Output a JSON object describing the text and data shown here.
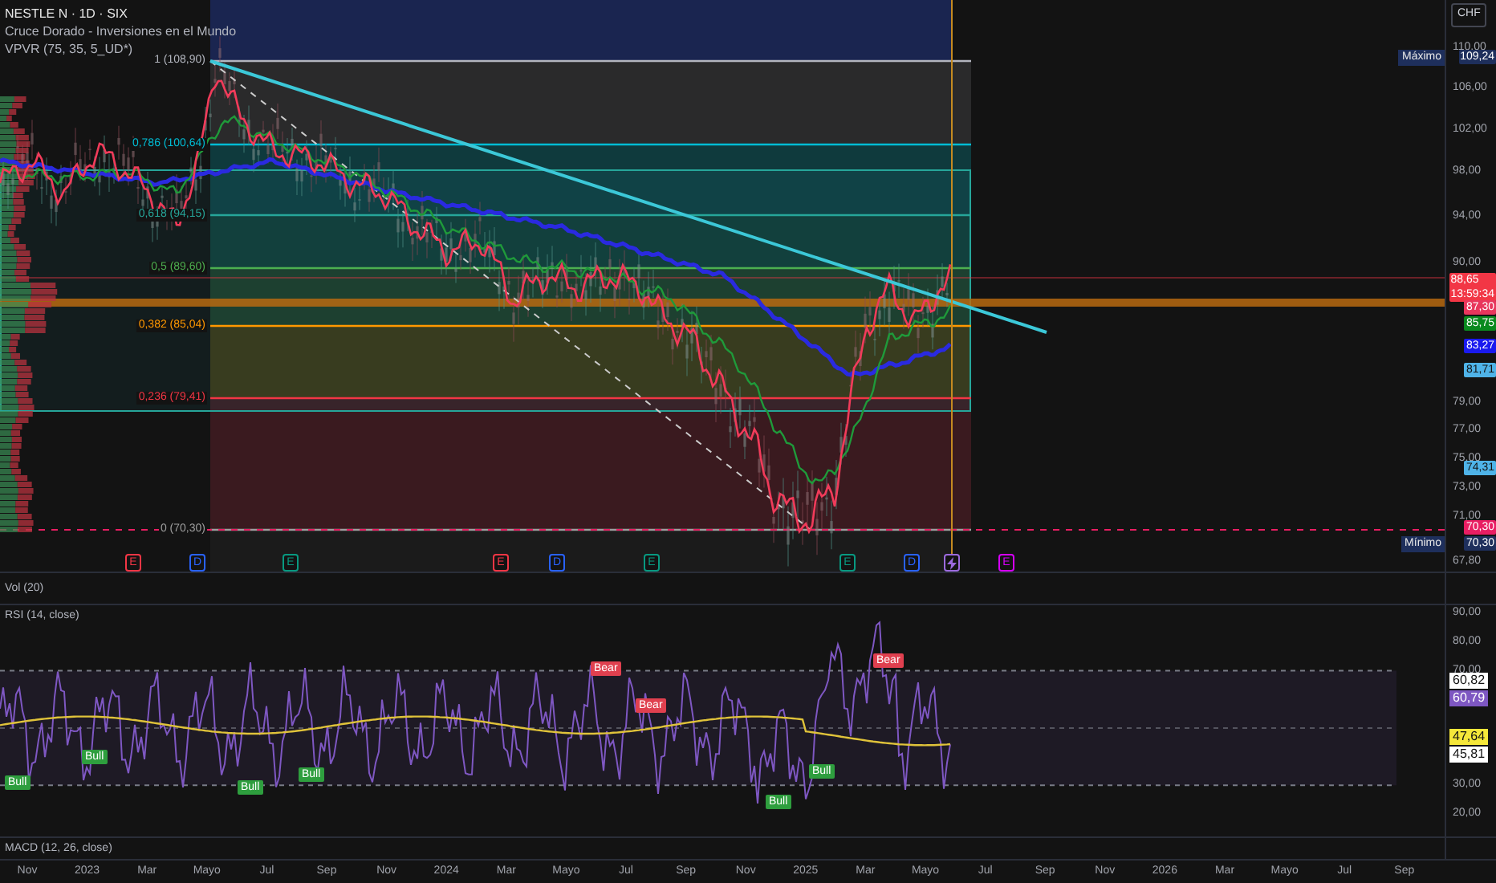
{
  "legend": [
    "NESTLE N · 1D · SIX",
    "Cruce Dorado - Inversiones en el Mundo",
    "VPVR (75, 35, 5_UD*)"
  ],
  "currency_button": "CHF",
  "price_axis": [
    "110,00",
    "106,00",
    "102,00",
    "98,00",
    "94,00",
    "90,00",
    "79,00",
    "77,00",
    "75,00",
    "73,00",
    "71,00",
    "67,80"
  ],
  "price_badges": [
    {
      "kind": "extreme",
      "label": "Máximo",
      "value": "109,24",
      "color": "#1e2f5c"
    },
    {
      "kind": "last",
      "value": "88,65",
      "countdown": "13:59:34",
      "color": "#f23645"
    },
    {
      "kind": "level",
      "value": "87,30",
      "color": "#e8365d"
    },
    {
      "kind": "level",
      "value": "85,75",
      "color": "#0a8a1e"
    },
    {
      "kind": "level",
      "value": "83,27",
      "color": "#1a1aef"
    },
    {
      "kind": "level",
      "value": "81,71",
      "color": "#4fb3e8"
    },
    {
      "kind": "level",
      "value": "74,31",
      "color": "#4fb3e8"
    },
    {
      "kind": "level",
      "value": "70,30",
      "color": "#e91e63"
    },
    {
      "kind": "extreme",
      "label": "Mínimo",
      "value": "70,30",
      "color": "#1e2f5c"
    }
  ],
  "fib_levels": [
    {
      "label": "1 (108,90)",
      "color": "#b2b5be"
    },
    {
      "label": "0,786 (100,64)",
      "color": "#00bcd4"
    },
    {
      "label": "0,618 (94,15)",
      "color": "#26a69a"
    },
    {
      "label": "0,5 (89,60)",
      "color": "#4caf50"
    },
    {
      "label": "0,382 (85,04)",
      "color": "#ff9800"
    },
    {
      "label": "0,236 (79,41)",
      "color": "#f23645"
    },
    {
      "label": "0 (70,30)",
      "color": "#9e9e9e"
    }
  ],
  "events": [
    {
      "kind": "earnings",
      "text": "E",
      "color": "#f23645"
    },
    {
      "kind": "dividend",
      "text": "D",
      "color": "#2962ff"
    },
    {
      "kind": "earnings",
      "text": "E",
      "color": "#089981"
    },
    {
      "kind": "earnings",
      "text": "E",
      "color": "#f23645"
    },
    {
      "kind": "dividend",
      "text": "D",
      "color": "#2962ff"
    },
    {
      "kind": "earnings",
      "text": "E",
      "color": "#089981"
    },
    {
      "kind": "earnings",
      "text": "E",
      "color": "#089981"
    },
    {
      "kind": "dividend",
      "text": "D",
      "color": "#2962ff"
    },
    {
      "kind": "news",
      "color": "#9c6ade"
    },
    {
      "kind": "earnings",
      "text": "E",
      "color": "#d500f9"
    }
  ],
  "panes": {
    "volume": "Vol (20)",
    "rsi": "RSI (14, close)",
    "macd": "MACD (12, 26, close)"
  },
  "rsi_axis": [
    "90,00",
    "80,00",
    "70,00",
    "30,00",
    "20,00"
  ],
  "rsi_badges": [
    {
      "value": "60,82",
      "color": "#ffffff"
    },
    {
      "value": "60,79",
      "color": "#7e57c2"
    },
    {
      "value": "47,64",
      "color": "#f5e73a"
    },
    {
      "value": "45,81",
      "color": "#ffffff"
    }
  ],
  "signals": [
    {
      "kind": "bull",
      "text": "Bull"
    },
    {
      "kind": "bull",
      "text": "Bull"
    },
    {
      "kind": "bull",
      "text": "Bull"
    },
    {
      "kind": "bull",
      "text": "Bull"
    },
    {
      "kind": "bear",
      "text": "Bear"
    },
    {
      "kind": "bear",
      "text": "Bear"
    },
    {
      "kind": "bull",
      "text": "Bull"
    },
    {
      "kind": "bull",
      "text": "Bull"
    },
    {
      "kind": "bear",
      "text": "Bear"
    }
  ],
  "time_axis": [
    "Nov",
    "2023",
    "Mar",
    "Mayo",
    "Jul",
    "Sep",
    "Nov",
    "2024",
    "Mar",
    "Mayo",
    "Jul",
    "Sep",
    "Nov",
    "2025",
    "Mar",
    "Mayo",
    "Jul",
    "Sep",
    "Nov",
    "2026",
    "Mar",
    "Mayo",
    "Jul",
    "Sep"
  ]
}
